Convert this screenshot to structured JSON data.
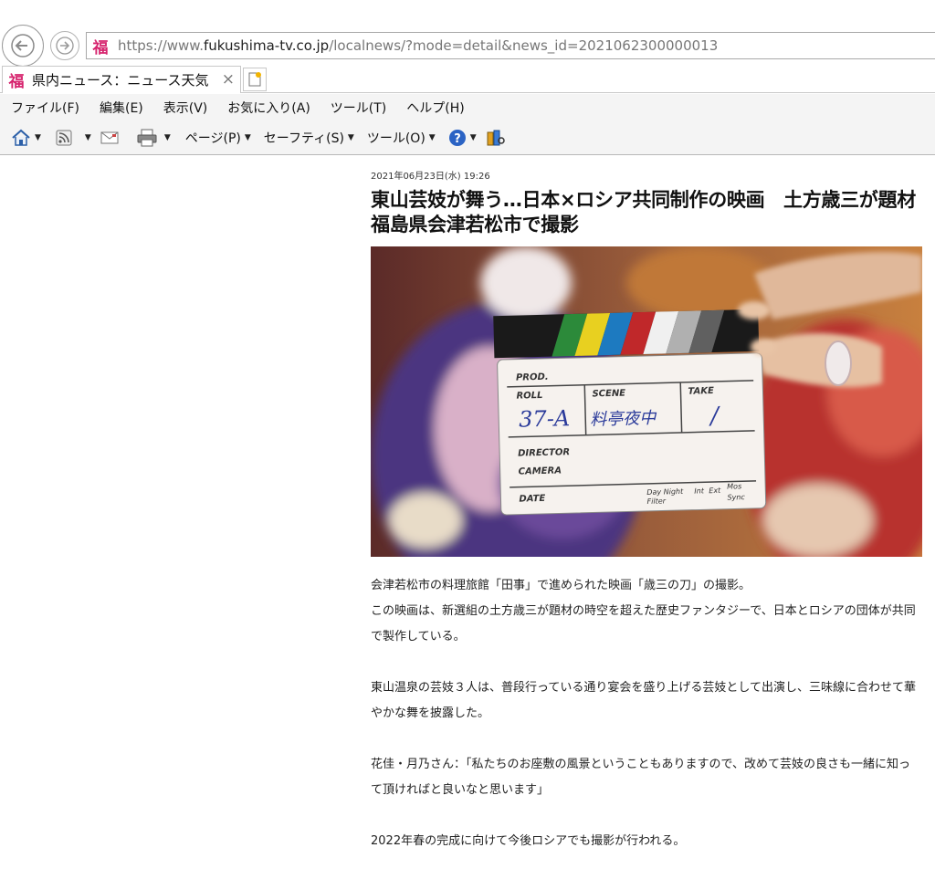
{
  "browser": {
    "url_prefix": "https://www.",
    "url_host": "fukushima-tv.co.jp",
    "url_path": "/localnews/?mode=detail&news_id=2021062300000013",
    "favicon_glyph": "福",
    "tab_title": "県内ニュース：ニュース天気｜...",
    "tab_close": "×"
  },
  "menu": {
    "items": [
      "ファイル(F)",
      "編集(E)",
      "表示(V)",
      "お気に入り(A)",
      "ツール(T)",
      "ヘルプ(H)"
    ]
  },
  "commandbar": {
    "page": "ページ(P)",
    "safety": "セーフティ(S)",
    "tools": "ツール(O)"
  },
  "article": {
    "date": "2021年06月23日(水)  19:26",
    "headline": "東山芸妓が舞う…日本×ロシア共同制作の映画　土方歳三が題材　福島県会津若松市で撮影",
    "photo": {
      "board_prod": "PROD.",
      "board_roll": "ROLL",
      "board_scene": "SCENE",
      "board_take": "TAKE",
      "board_roll_value": "37-A",
      "board_scene_value": "料亭夜中",
      "board_take_value": "/",
      "board_director": "DIRECTOR",
      "board_camera": "CAMERA",
      "board_date": "DATE",
      "board_daynight": "Day Night",
      "board_filter": "Filter",
      "board_int": "Int",
      "board_ext": "Ext",
      "board_mos": "Mos",
      "board_sync": "Sync"
    },
    "paragraphs": [
      "会津若松市の料理旅館「田事」で進められた映画「歳三の刀」の撮影。",
      "この映画は、新選組の土方歳三が題材の時空を超えた歴史ファンタジーで、日本とロシアの団体が共同で製作している。",
      "東山温泉の芸妓３人は、普段行っている通り宴会を盛り上げる芸妓として出演し、三味線に合わせて華やかな舞を披露した。",
      "花佳・月乃さん：「私たちのお座敷の風景ということもありますので、改めて芸妓の良さも一緒に知って頂ければと良いなと思います」",
      "2022年春の完成に向けて今後ロシアでも撮影が行われる。"
    ]
  },
  "colors": {
    "favicon": "#d6246e",
    "kimono_purple": "#5a3a8a",
    "kimono_red": "#c8383a"
  }
}
